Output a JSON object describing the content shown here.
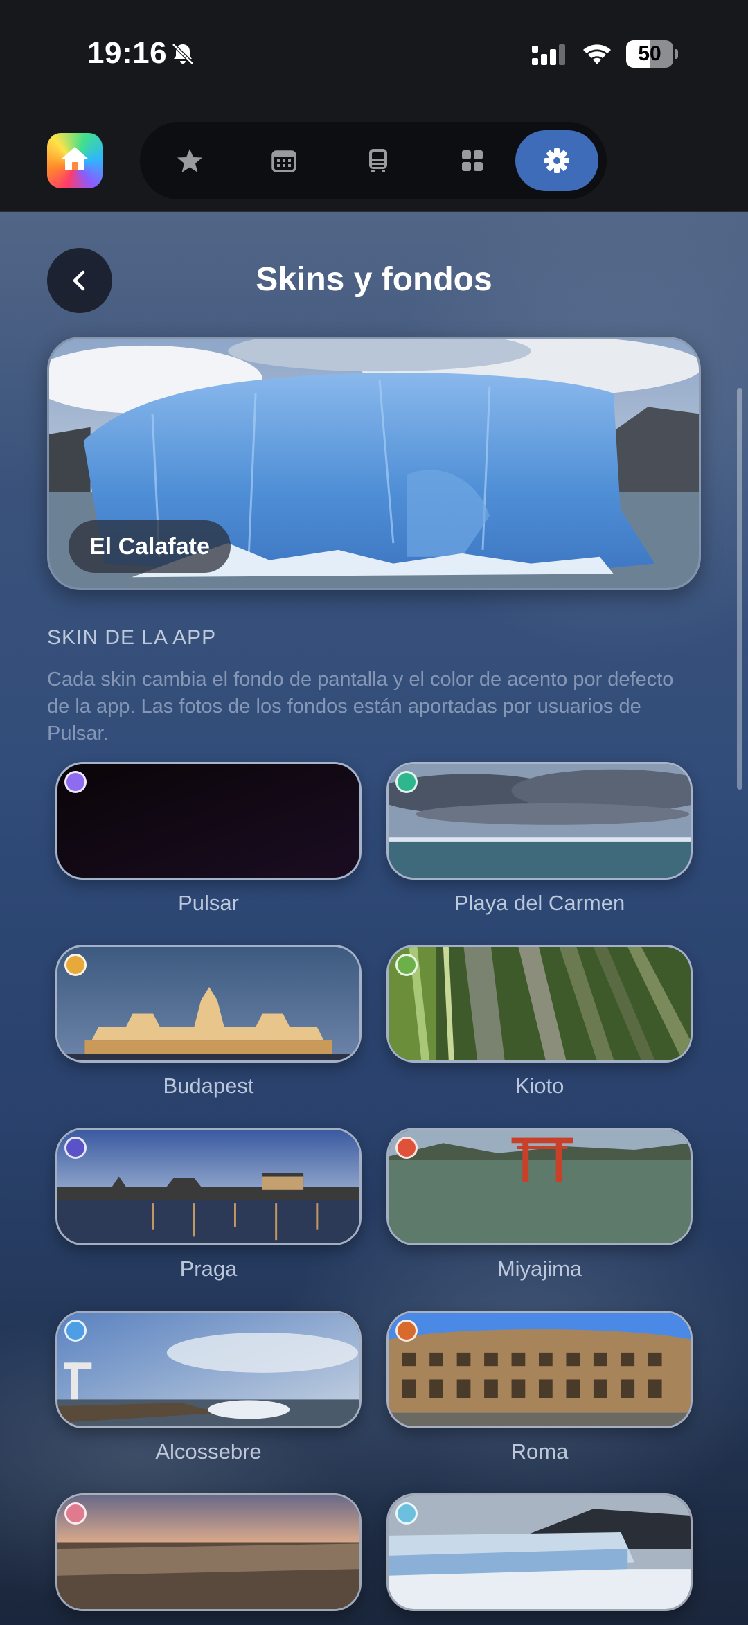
{
  "status_bar": {
    "time": "19:16",
    "battery_percent": "50",
    "battery_level": 0.5
  },
  "top_nav": {
    "app_icon": "home-icon",
    "tabs": [
      {
        "icon": "star-icon",
        "active": false
      },
      {
        "icon": "calendar-icon",
        "active": false
      },
      {
        "icon": "train-icon",
        "active": false
      },
      {
        "icon": "grid-icon",
        "active": false
      },
      {
        "icon": "gear-icon",
        "active": true
      }
    ],
    "accent_color": "#3e6cb8"
  },
  "header": {
    "title": "Skins y fondos"
  },
  "hero": {
    "label": "El Calafate"
  },
  "section": {
    "title": "SKIN DE LA APP",
    "description": "Cada skin cambia el fondo de pantalla y el color de acento por defecto de la app. Las fotos de los fondos están aportadas por usuarios de Pulsar."
  },
  "skins": [
    {
      "name": "Pulsar",
      "accent": "#8e6cf0"
    },
    {
      "name": "Playa del Carmen",
      "accent": "#2eb68c"
    },
    {
      "name": "Budapest",
      "accent": "#e6a93a"
    },
    {
      "name": "Kioto",
      "accent": "#6cb04a"
    },
    {
      "name": "Praga",
      "accent": "#5a52c8"
    },
    {
      "name": "Miyajima",
      "accent": "#e0513a"
    },
    {
      "name": "Alcossebre",
      "accent": "#4e9ee6"
    },
    {
      "name": "Roma",
      "accent": "#d86a2e"
    },
    {
      "name": "",
      "accent": "#e07a8e"
    },
    {
      "name": "",
      "accent": "#6cc0de"
    }
  ]
}
